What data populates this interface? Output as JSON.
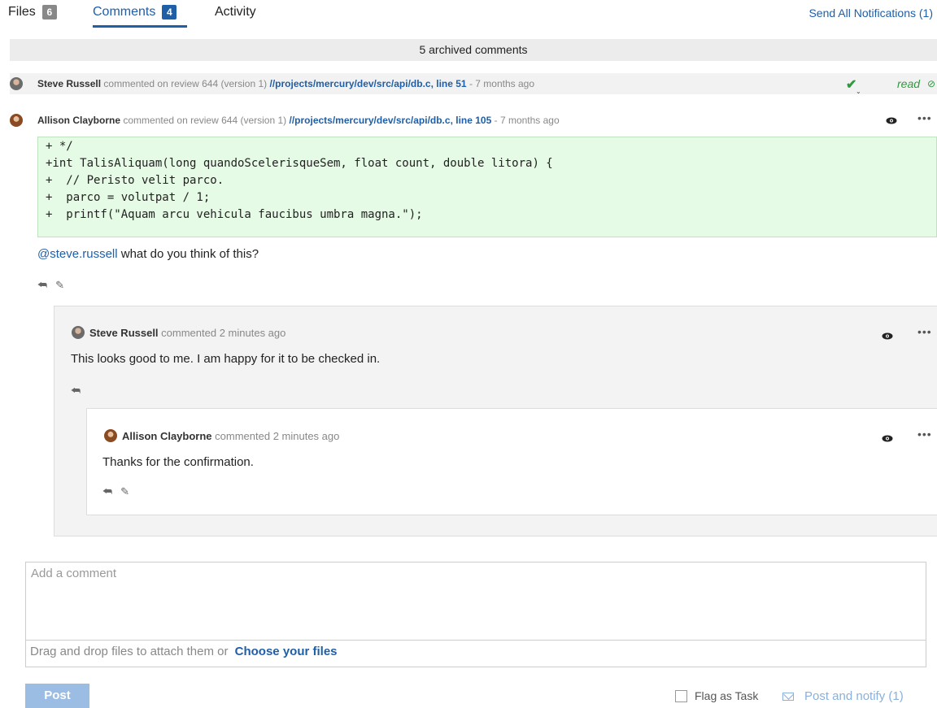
{
  "tabs": [
    {
      "label": "Files",
      "count": "6"
    },
    {
      "label": "Comments",
      "count": "4"
    },
    {
      "label": "Activity"
    }
  ],
  "send_all": "Send All Notifications (1)",
  "archived": "5 archived comments",
  "comment1": {
    "author": "Steve Russell",
    "action": "commented on review 644 (version 1)",
    "file": "//projects/mercury/dev/src/api/db.c, line 51",
    "time": "- 7 months ago",
    "status": "read"
  },
  "comment2": {
    "author": "Allison Clayborne",
    "action": "commented on review 644 (version 1)",
    "file": "//projects/mercury/dev/src/api/db.c, line 105",
    "time": "- 7 months ago",
    "code": [
      "+ */",
      "+int TalisAliquam(long quandoScelerisqueSem, float count, double litora) {",
      "+  // Peristo velit parco.",
      "+  parco = volutpat / 1;",
      "+  printf(\"Aquam arcu vehicula faucibus umbra magna.\");"
    ],
    "mention": "@steve.russell",
    "body": " what do you think of this?"
  },
  "reply1": {
    "author": "Steve Russell",
    "meta": "commented 2 minutes ago",
    "body": "This looks good to me. I am happy for it to be checked in."
  },
  "reply2": {
    "author": "Allison Clayborne",
    "meta": "commented 2 minutes ago",
    "body": "Thanks for the confirmation."
  },
  "composer": {
    "placeholder": "Add a comment",
    "drop_hint": "Drag and drop files to attach them or",
    "choose_files": "Choose your files",
    "post": "Post",
    "flag_task": "Flag as Task",
    "post_notify": "Post and notify (1)"
  },
  "colors": {
    "accent": "#1f5fa8",
    "success": "#2e9a3f",
    "code_bg": "#e6fbe6"
  }
}
